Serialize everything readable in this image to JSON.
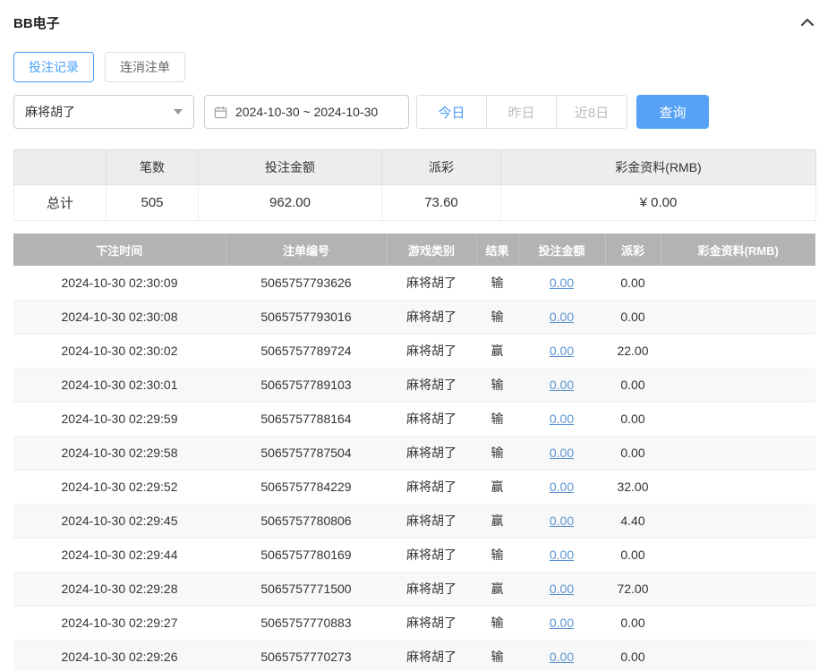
{
  "header": {
    "title": "BB电子"
  },
  "tabs": [
    {
      "label": "投注记录"
    },
    {
      "label": "连消注单"
    }
  ],
  "filters": {
    "game": "麻将胡了",
    "date_range": "2024-10-30 ~ 2024-10-30",
    "quick": [
      {
        "label": "今日"
      },
      {
        "label": "昨日"
      },
      {
        "label": "近8日"
      }
    ],
    "search": "查询"
  },
  "summary": {
    "headers": [
      "",
      "笔数",
      "投注金额",
      "派彩",
      "彩金资料(RMB)"
    ],
    "total_label": "总计",
    "count": "505",
    "bet_amount": "962.00",
    "payout": "73.60",
    "bonus": "¥ 0.00"
  },
  "table": {
    "headers": [
      "下注时间",
      "注单编号",
      "游戏类别",
      "结果",
      "投注金额",
      "派彩",
      "彩金资料(RMB)"
    ],
    "rows": [
      {
        "time": "2024-10-30 02:30:09",
        "order_id": "5065757793626",
        "game": "麻将胡了",
        "result": "输",
        "bet": "0.00",
        "payout": "0.00",
        "bonus": ""
      },
      {
        "time": "2024-10-30 02:30:08",
        "order_id": "5065757793016",
        "game": "麻将胡了",
        "result": "输",
        "bet": "0.00",
        "payout": "0.00",
        "bonus": ""
      },
      {
        "time": "2024-10-30 02:30:02",
        "order_id": "5065757789724",
        "game": "麻将胡了",
        "result": "赢",
        "bet": "0.00",
        "payout": "22.00",
        "bonus": ""
      },
      {
        "time": "2024-10-30 02:30:01",
        "order_id": "5065757789103",
        "game": "麻将胡了",
        "result": "输",
        "bet": "0.00",
        "payout": "0.00",
        "bonus": ""
      },
      {
        "time": "2024-10-30 02:29:59",
        "order_id": "5065757788164",
        "game": "麻将胡了",
        "result": "输",
        "bet": "0.00",
        "payout": "0.00",
        "bonus": ""
      },
      {
        "time": "2024-10-30 02:29:58",
        "order_id": "5065757787504",
        "game": "麻将胡了",
        "result": "输",
        "bet": "0.00",
        "payout": "0.00",
        "bonus": ""
      },
      {
        "time": "2024-10-30 02:29:52",
        "order_id": "5065757784229",
        "game": "麻将胡了",
        "result": "赢",
        "bet": "0.00",
        "payout": "32.00",
        "bonus": ""
      },
      {
        "time": "2024-10-30 02:29:45",
        "order_id": "5065757780806",
        "game": "麻将胡了",
        "result": "赢",
        "bet": "0.00",
        "payout": "4.40",
        "bonus": ""
      },
      {
        "time": "2024-10-30 02:29:44",
        "order_id": "5065757780169",
        "game": "麻将胡了",
        "result": "输",
        "bet": "0.00",
        "payout": "0.00",
        "bonus": ""
      },
      {
        "time": "2024-10-30 02:29:28",
        "order_id": "5065757771500",
        "game": "麻将胡了",
        "result": "赢",
        "bet": "0.00",
        "payout": "72.00",
        "bonus": ""
      },
      {
        "time": "2024-10-30 02:29:27",
        "order_id": "5065757770883",
        "game": "麻将胡了",
        "result": "输",
        "bet": "0.00",
        "payout": "0.00",
        "bonus": ""
      },
      {
        "time": "2024-10-30 02:29:26",
        "order_id": "5065757770273",
        "game": "麻将胡了",
        "result": "输",
        "bet": "0.00",
        "payout": "0.00",
        "bonus": ""
      }
    ]
  },
  "colors": {
    "accent": "#49a0f8",
    "search_button_bg": "#57a2f6",
    "table_header_bg": "#b3b3b3",
    "link": "#5b93cf"
  }
}
